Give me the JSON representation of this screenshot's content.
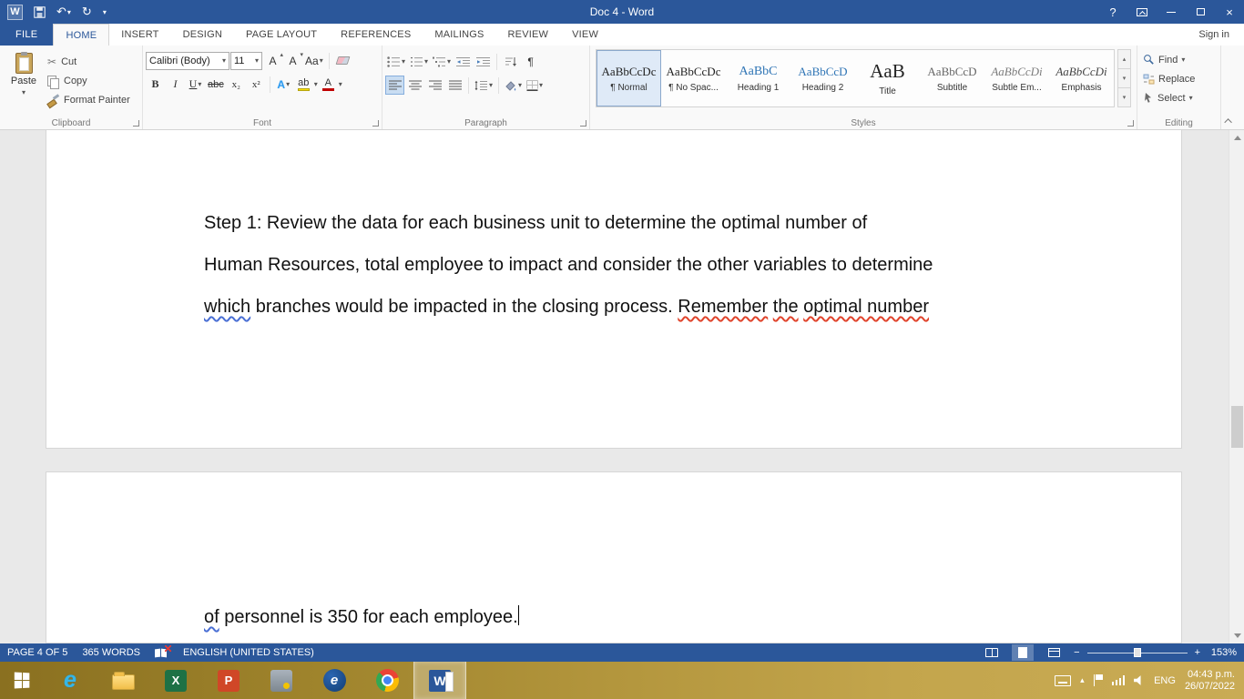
{
  "colors": {
    "accent": "#2b579a",
    "squiggle_red": "#e0442c",
    "squiggle_blue": "#4a6fd4",
    "highlight_yellow": "#fce303",
    "font_color_red": "#c00000",
    "taskbar_gold": "#b2953c"
  },
  "icons": {
    "chevron_down": "▾",
    "chevron_up": "▴",
    "cut": "✂",
    "undo": "↶",
    "redo": "↻",
    "close": "×",
    "help": "?",
    "pilcrow": "¶"
  },
  "title_bar": {
    "app_glyph": "W",
    "title": "Doc 4 - Word"
  },
  "tab_row": {
    "file": "FILE",
    "tabs": [
      "HOME",
      "INSERT",
      "DESIGN",
      "PAGE LAYOUT",
      "REFERENCES",
      "MAILINGS",
      "REVIEW",
      "VIEW"
    ],
    "sign_in": "Sign in"
  },
  "ribbon": {
    "clipboard": {
      "label": "Clipboard",
      "paste": "Paste",
      "cut": "Cut",
      "copy": "Copy",
      "format_painter": "Format Painter"
    },
    "font": {
      "label": "Font",
      "name": "Calibri (Body)",
      "size": "11",
      "grow": "A",
      "shrink": "A",
      "change_case": "Aa",
      "bold": "B",
      "italic": "I",
      "underline": "U",
      "strikethrough": "abc",
      "subscript": "x₂",
      "superscript": "x²",
      "text_effects": "A",
      "highlight": "ab",
      "font_color": "A"
    },
    "paragraph": {
      "label": "Paragraph"
    },
    "styles": {
      "label": "Styles",
      "items": [
        {
          "preview": "AaBbCcDc",
          "name": "¶ Normal"
        },
        {
          "preview": "AaBbCcDc",
          "name": "¶ No Spac..."
        },
        {
          "preview": "AaBbC",
          "name": "Heading 1"
        },
        {
          "preview": "AaBbCcD",
          "name": "Heading 2"
        },
        {
          "preview": "AaB",
          "name": "Title"
        },
        {
          "preview": "AaBbCcD",
          "name": "Subtitle"
        },
        {
          "preview": "AaBbCcDi",
          "name": "Subtle Em..."
        },
        {
          "preview": "AaBbCcDi",
          "name": "Emphasis"
        }
      ]
    },
    "editing": {
      "label": "Editing",
      "find": "Find",
      "replace": "Replace",
      "select": "Select"
    }
  },
  "document": {
    "page1_lines": [
      "Step 1: Review the data for each business unit to determine the optimal number of",
      "Human Resources, total employee to impact and consider the other variables to determine"
    ],
    "page1_line3": [
      "which",
      " branches would be impacted in the closing process. ",
      "Remember",
      " ",
      "the",
      " ",
      "optimal number"
    ],
    "page2_line": [
      "of",
      " personnel is 350 for each employee."
    ]
  },
  "status_bar": {
    "page": "PAGE 4 OF 5",
    "words": "365 WORDS",
    "language": "ENGLISH (UNITED STATES)",
    "zoom_out": "−",
    "zoom_in": "+",
    "zoom_level": "153%"
  },
  "taskbar": {
    "ie_glyph": "e",
    "excel_glyph": "X",
    "powerpoint_glyph": "P",
    "edge_glyph": "e",
    "word_glyph": "W",
    "language": "ENG",
    "time": "04:43 p.m.",
    "date": "26/07/2022"
  }
}
